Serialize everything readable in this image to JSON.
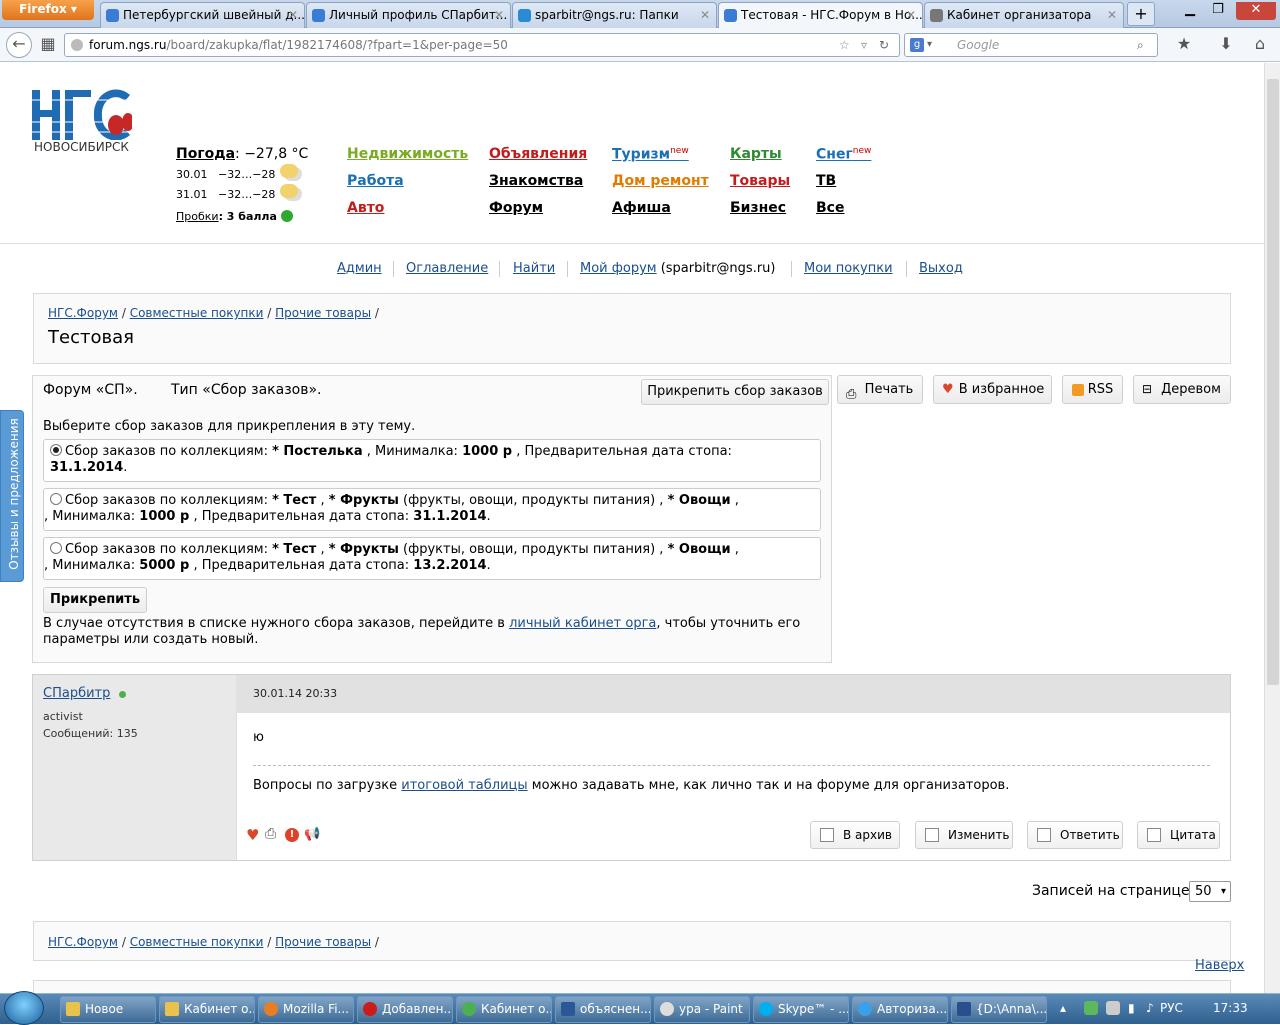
{
  "browser": {
    "menu_button": "Firefox",
    "tabs": [
      {
        "title": "Петербургский швейный д..."
      },
      {
        "title": "Личный профиль СПарбит..."
      },
      {
        "title": "sparbitr@ngs.ru: Папки"
      },
      {
        "title": "Тестовая - НГС.Форум в Но..."
      },
      {
        "title": "Кабинет организатора"
      }
    ],
    "new_tab": "+",
    "url_host": "forum.ngs.ru",
    "url_path": "/board/zakupka/flat/1982174608/?fpart=1&per-page=50",
    "search_placeholder": "Google"
  },
  "header": {
    "logo_text": "НГС",
    "city": "НОВОСИБИРСК",
    "weather_label": "Погода",
    "weather_value": ": −27,8 °C",
    "forecast": [
      {
        "date": "30.01",
        "temps": "−32…−28"
      },
      {
        "date": "31.01",
        "temps": "−32…−28"
      }
    ],
    "traffic_label": "Пробки",
    "traffic_value": ": 3 балла",
    "services": [
      {
        "label": "Недвижимость",
        "color": "#7aab23"
      },
      {
        "label": "Объявления",
        "color": "#c41b1b"
      },
      {
        "label": "Туризм",
        "color": "#1a6fb5",
        "badge": "new"
      },
      {
        "label": "Карты",
        "color": "#2e8a2e"
      },
      {
        "label": "Снег",
        "color": "#1a6fb5",
        "badge": "new"
      },
      {
        "label": "Работа",
        "color": "#1a6fb5"
      },
      {
        "label": "Знакомства",
        "color": "#000000"
      },
      {
        "label": "Дом ремонт",
        "color": "#e07b00"
      },
      {
        "label": "Товары",
        "color": "#c41b1b"
      },
      {
        "label": "ТВ",
        "color": "#000000"
      },
      {
        "label": "Авто",
        "color": "#c41b1b"
      },
      {
        "label": "Форум",
        "color": "#000000"
      },
      {
        "label": "Афиша",
        "color": "#000000"
      },
      {
        "label": "Бизнес",
        "color": "#000000"
      },
      {
        "label": "Все",
        "color": "#000000"
      }
    ]
  },
  "topnav": {
    "admin": "Админ",
    "contents": "Оглавление",
    "find": "Найти",
    "myforum": "Мой форум",
    "myforum_user": " (sparbitr@ngs.ru)",
    "purchases": "Мои покупки",
    "logout": "Выход"
  },
  "breadcrumb": {
    "forum": "НГС.Форум",
    "section": "Совместные покупки",
    "subsection": "Прочие товары",
    "sep": "/"
  },
  "page_title": "Тестовая",
  "tools": {
    "print": "Печать",
    "favorite": "В избранное",
    "rss": "RSS",
    "tree": "Деревом"
  },
  "attach": {
    "forum_label": "Форум «СП».",
    "type_label": "Тип «Сбор заказов».",
    "attach_button": "Прикрепить сбор заказов",
    "instruction": "Выберите сбор заказов для прикрепления в эту тему.",
    "options": [
      {
        "selected": true,
        "prefix": "Сбор заказов по коллекциям: ",
        "c1": "* Постелька",
        "mid1": " , Минималка: ",
        "min": "1000 р",
        "mid2": " , Предварительная дата стопа: ",
        "date": "31.1.2014"
      },
      {
        "selected": false,
        "prefix": "Сбор заказов по коллекциям: ",
        "c1": "* Тест",
        "mid0": " , ",
        "c2": "* Фрукты",
        "desc": " (фрукты, овощи, продукты питания) , ",
        "c3": "* Овощи",
        "mid1": " , Минималка: ",
        "min": "1000 р",
        "mid2": " , Предварительная дата стопа: ",
        "date": "31.1.2014"
      },
      {
        "selected": false,
        "prefix": "Сбор заказов по коллекциям: ",
        "c1": "* Тест",
        "mid0": " , ",
        "c2": "* Фрукты",
        "desc": " (фрукты, овощи, продукты питания) , ",
        "c3": "* Овощи",
        "mid1": " , Минималка: ",
        "min": "5000 р",
        "mid2": " , Предварительная дата стопа: ",
        "date": "13.2.2014"
      }
    ],
    "submit": "Прикрепить",
    "note_before": "В случае отсутствия в списке нужного сбора заказов, перейдите в ",
    "note_link": "личный кабинет орга",
    "note_after": ", чтобы уточнить его параметры или создать новый."
  },
  "post": {
    "author": "СПарбитр",
    "rank": "activist",
    "messages": "Сообщений: 135",
    "date": "30.01.14 20:33",
    "body": "ю",
    "signature_before": "Вопросы по загрузке ",
    "signature_link": "итоговой таблицы",
    "signature_after": " можно задавать мне, как лично так и на форуме для организаторов.",
    "actions": {
      "archive": "В архив",
      "edit": "Изменить",
      "reply": "Ответить",
      "quote": "Цитата"
    }
  },
  "pager": {
    "label": "Записей на странице:",
    "value": "50"
  },
  "bottom": {
    "to_top": "Наверх"
  },
  "feedback_tab": "Отзывы и предложения",
  "taskbar": {
    "items": [
      "Новое",
      "Кабинет о...",
      "Mozilla Fi...",
      "Добавлен...",
      "Кабинет о...",
      "объяснен...",
      "ypa - Paint",
      "Skype™ - ...",
      "Авториза...",
      "{D:\\Anna\\..."
    ],
    "lang": "РУС",
    "time": "17:33"
  }
}
